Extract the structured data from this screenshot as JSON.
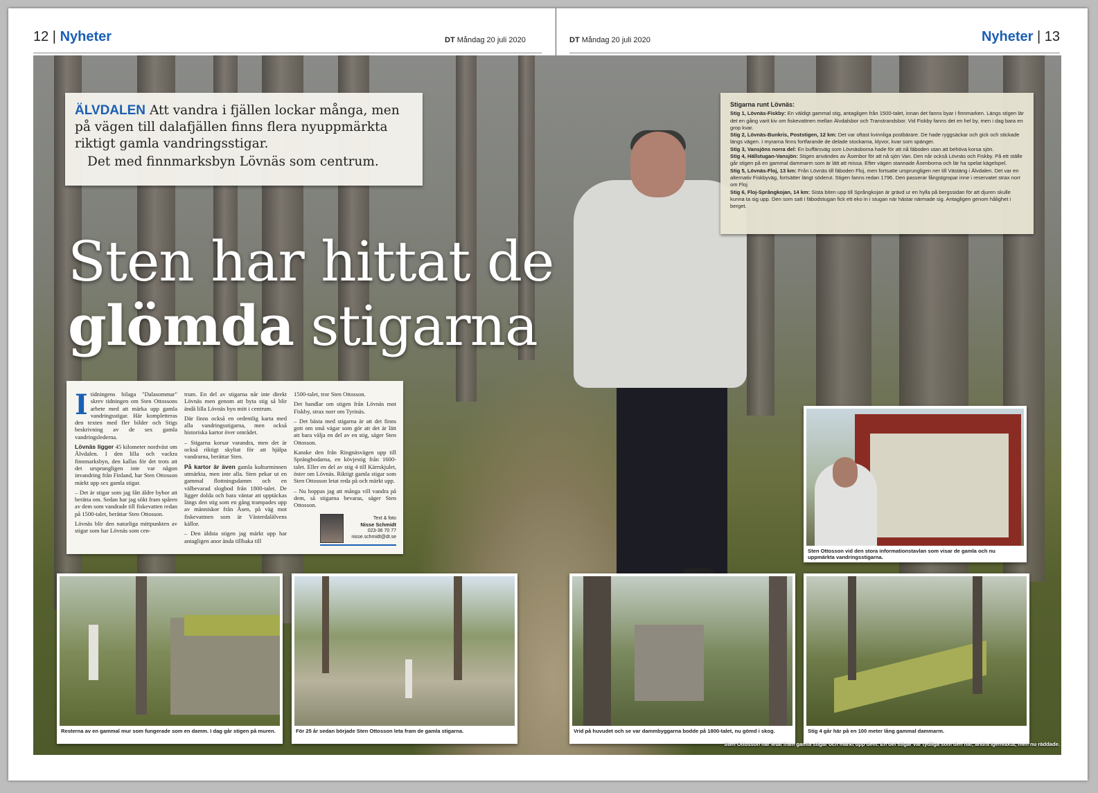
{
  "left_page": {
    "number": "12",
    "section": "Nyheter",
    "paper": "DT",
    "date": "Måndag 20 juli 2020"
  },
  "right_page": {
    "number": "13",
    "section": "Nyheter",
    "paper": "DT",
    "date": "Måndag 20 juli 2020"
  },
  "lead": {
    "kicker": "ÄLVDALEN",
    "text": "Att vandra i fjällen lockar många, men på vägen till dalafjällen finns flera nyuppmärkta riktigt gamla vandringsstigar.",
    "text2": "Det med finnmarksbyn Lövnäs som centrum."
  },
  "headline": {
    "line1": "Sten har hittat de",
    "bold_word": "glömda",
    "rest": "stigarna"
  },
  "body": {
    "dropcap": "I",
    "col1_p1": "tidningens bilaga \"Dalasommar\" skrev tidningen om Sten Ottossons arbete med att märka upp gamla vandringsstigar. Här kompletteras den texten med fler bilder och Stigs beskrivning av de sex gamla vandringslederna.",
    "col1_p2_lead": "Lövnäs ligger",
    "col1_p2": "45 kilometer nordväst om Älvdalen. I den lilla och vackra finnmarksbyn, den kallas för det trots att det ursprungligen inte var någon invandring från Finland, har Sten Ottosson märkt upp sex gamla stigar.",
    "col1_p3": "– Det är stigar som jag fått äldre bybor att berätta om. Sedan har jag sökt fram spåren av dem som vandrade till fiskevatten redan på 1500-talet, berättar Sten Ottosson.",
    "col1_p4": "Lövnäs blir den naturliga mittpunkten av stigar som har Lövnäs som cen-",
    "col2_p1": "trum. En del av stigarna når inte direkt Lövnäs men genom att byta stig så blir ändå lilla Lövnäs byn mitt i centrum.",
    "col2_p2": "Där finns också en ordentlig karta med alla vandringsstigarna, men också historiska kartor över området.",
    "col2_p3": "– Stigarna korsar varandra, men det är också riktigt skyltat för att hjälpa vandrarna, berättar Sten.",
    "col2_p4_lead": "På kartor är även",
    "col2_p4": "gamla kulturminnen utmärkta, men inte alla. Sten pekar ut en gammal flottningsdamm och en välbevarad slogbod från 1800-talet. De ligger dolda och bara väntar att upptäckas längs den stig som en gång trampades upp av människor från Åsen, på väg mot fiskevattnen som är Västerdalälvens källor.",
    "col2_p5": "– Den äldsta stigen jag märkt upp har antagligen anor ända tillbaka till",
    "col3_p1": "1500-talet, tror Sten Ottosson.",
    "col3_p2": "Det handlar om stigen från Lövnäs mot Fiskby, strax norr om Tyrinäs.",
    "col3_p3": "– Det bästa med stigarna är att det finns gott om små vägar som gör att det är lätt att bara välja en del av en stig, säger Sten Ottosson.",
    "col3_p4": "Kanske den från Ringnäsvägen upp till Sprängbodarna, en kövjestig från 1600-talet. Eller en del av stig 4 till Kärrskjulet, öster om Lövnäs. Riktigt gamla stigar som Sten Ottosson letat reda på och märkt upp.",
    "col3_p5": "– Nu hoppas jag att många vill vandra på dem, så stigarna bevaras, säger Sten Ottosson.",
    "byline_label": "Text & foto",
    "byline_name": "Nisse Schmidt",
    "byline_phone": "023-36 70 77",
    "byline_email": "nisse.schmidt@dt.se"
  },
  "factbox": {
    "title": "Stigarna runt Lövnäs:",
    "stigar": [
      {
        "name": "Stig 1, Lövnäs-Fiskby:",
        "text": "En väldigt gammal stig, antagligen från 1500-talet, innan det fanns byar i finnmarken. Längs stigen lär det en gång varit kiv om fiskevattnen mellan Älvdalsbor och Transtrandsbor. Vid Fiskby fanns det en hel by, men i dag bara en grop kvar."
      },
      {
        "name": "Stig 2, Lövnäs-Bunkris, Poststigen, 12 km:",
        "text": "Det var oftast kvinnliga postbärare. De hade ryggsäckar och gick och stickade längs vägen. I myrarna finns fortfarande de delade stockarna, klyvor, kvar som spänger."
      },
      {
        "name": "Stig 3, Vansjöns norra del:",
        "text": "En buffärsväg som Lövnäsborna hade för att nå fäboden utan att behöva korsa sjön."
      },
      {
        "name": "Stig 4, Hällstugan-Vansjön:",
        "text": "Stigen användes av Åsenbor för att nå sjön Van. Den når också Lövnäs och Fiskby. På ett ställe går stigen på en gammal dammarm som är lätt att missa. Efter vägen stannade Åsenborna och lär ha spelat kägelspel."
      },
      {
        "name": "Stig 5, Lövnäs-Floj, 13 km:",
        "text": "Från Lövnäs till fäboden Floj, men fortsatte ursprungligen ner till Västäng i Älvdalen. Det var en alternativ Fiskbyväg, fortsätter längt söderut. Stigen fanns redan 1796. Den passerar fångstgropar inne i reservatet strax norr om Floj"
      },
      {
        "name": "Stig 6, Floj-Språngkojan, 14 km:",
        "text": "Sista biten upp till Språngkojan är grävd ur en hylla på bergssidan för att djuren skulle kunna ta sig upp. Den som satt i fäbodstugan fick ett eko in i stugan när hästar närmade sig. Antagligen genom hålighet i berget."
      }
    ]
  },
  "photos": {
    "p1_caption": "Resterna av en gammal mur som fungerade som en damm. I dag går stigen på muren.",
    "p2_caption": "För 25 år sedan började Sten Ottosson leta fram de gamla stigarna.",
    "p3_caption": "Vrid på huvudet och se var dammbyggarna bodde på 1800-talet, nu gömd i skog.",
    "p4_caption": "Stig 4 går här på en 100 meter lång gammal dammarm.",
    "p5_caption": "Sten Ottosson vid den stora informationstavlan som visar de gamla och nu uppmärkta vandringsstigarna.",
    "main_caption": "Sten Ottosson har letat fram gamla stigar och märkt upp dem. En del stigar var tydliga som den här, andra igenväxta, men nu räddade."
  }
}
